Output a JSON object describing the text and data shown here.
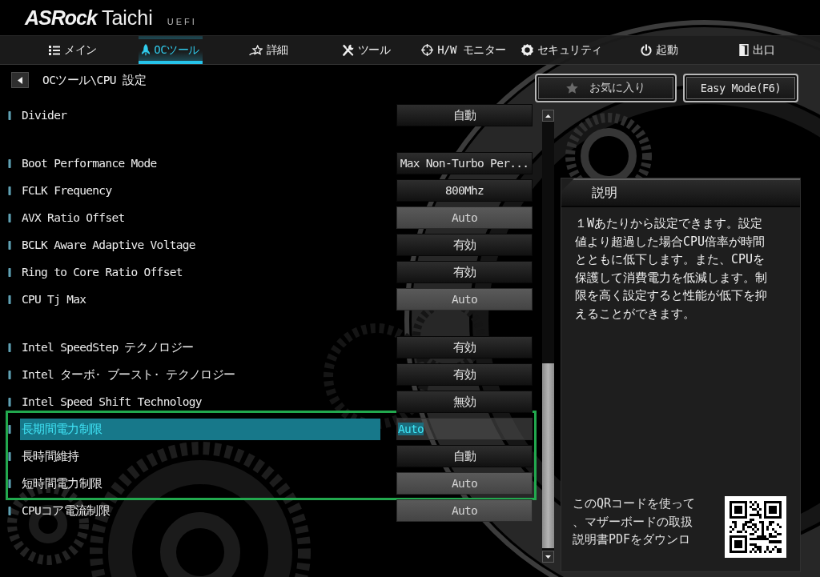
{
  "header": {
    "brand": "ASRock",
    "model": "Taichi",
    "firmware": "UEFI"
  },
  "tabs": [
    {
      "label": "メイン",
      "selected": false
    },
    {
      "label": "OCツール",
      "selected": true
    },
    {
      "label": "詳細",
      "selected": false
    },
    {
      "label": "ツール",
      "selected": false
    },
    {
      "label": "H/W モニター",
      "selected": false
    },
    {
      "label": "セキュリティ",
      "selected": false
    },
    {
      "label": "起動",
      "selected": false
    },
    {
      "label": "出口",
      "selected": false
    }
  ],
  "breadcrumb": "OCツール\\CPU 設定",
  "favorites_button": {
    "label": "お気に入り"
  },
  "easy_mode_button": {
    "label": "Easy Mode(F6)"
  },
  "sections": [
    {
      "rows": [
        {
          "label": "Divider",
          "value": "自動",
          "kind": "select",
          "selected": false,
          "framed": false
        }
      ]
    },
    {
      "rows": [
        {
          "label": "Boot Performance Mode",
          "value": "Max Non-Turbo Per...",
          "kind": "select",
          "selected": false,
          "framed": false
        },
        {
          "label": "FCLK Frequency",
          "value": "800Mhz",
          "kind": "select",
          "selected": false,
          "framed": false
        },
        {
          "label": "AVX Ratio Offset",
          "value": "Auto",
          "kind": "input",
          "selected": false,
          "framed": false
        },
        {
          "label": "BCLK Aware Adaptive Voltage",
          "value": "有効",
          "kind": "select",
          "selected": false,
          "framed": false
        },
        {
          "label": "Ring to Core Ratio Offset",
          "value": "有効",
          "kind": "select",
          "selected": false,
          "framed": false
        },
        {
          "label": "CPU Tj Max",
          "value": "Auto",
          "kind": "input",
          "selected": false,
          "framed": false
        }
      ]
    },
    {
      "rows": [
        {
          "label": "Intel SpeedStep テクノロジー",
          "value": "有効",
          "kind": "select",
          "selected": false,
          "framed": false
        },
        {
          "label": "Intel ターボ· ブースト· テクノロジー",
          "value": "有効",
          "kind": "select",
          "selected": false,
          "framed": false
        },
        {
          "label": "Intel Speed Shift Technology",
          "value": "無効",
          "kind": "select",
          "selected": false,
          "framed": false
        },
        {
          "label": "長期間電力制限",
          "value": "Auto",
          "kind": "input",
          "selected": true,
          "framed": true
        },
        {
          "label": "長時間維持",
          "value": "自動",
          "kind": "select",
          "selected": false,
          "framed": true
        },
        {
          "label": "短時間電力制限",
          "value": "Auto",
          "kind": "input",
          "selected": false,
          "framed": true
        },
        {
          "label": "CPUコア電流制限",
          "value": "Auto",
          "kind": "input",
          "selected": false,
          "framed": false
        }
      ]
    }
  ],
  "description": {
    "title": "説明",
    "lines": [
      "１Wあたりから設定できます。設定",
      "値より超過した場合CPU倍率が時間",
      "とともに低下します。また、CPUを",
      "保護して消費電力を低減します。制",
      "限を高く設定すると性能が低下を抑",
      "えることができます。"
    ]
  },
  "qr_caption": {
    "lines": [
      "このQRコードを使って",
      "、マザーボードの取扱",
      "説明書PDFをダウンロ"
    ]
  }
}
